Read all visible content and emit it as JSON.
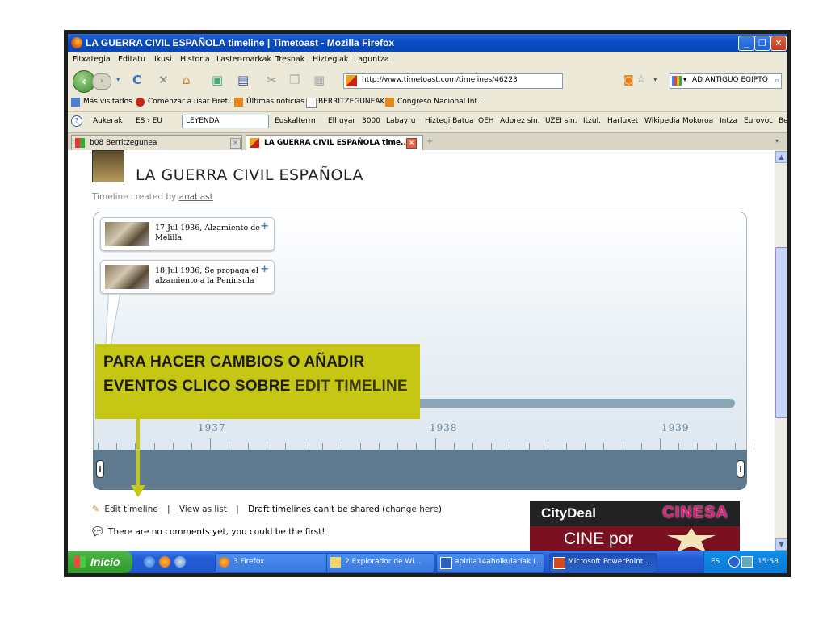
{
  "window": {
    "title": "LA GUERRA CIVIL ESPAÑOLA timeline | Timetoast - Mozilla Firefox",
    "controls": {
      "minimize": "_",
      "maximize": "❐",
      "close": "✕"
    }
  },
  "menu": {
    "items": [
      "Fitxategia",
      "Editatu",
      "Ikusi",
      "Historia",
      "Laster-markak",
      "Tresnak",
      "Hiztegiak",
      "Laguntza"
    ]
  },
  "navbar": {
    "url": "http://www.timetoast.com/timelines/46223",
    "search_text": "AD ANTIGUO EGIPTO"
  },
  "bookmarks": [
    "Más visitados",
    "Comenzar a usar Firef...",
    "Últimas noticias",
    "BERRITZEGUNEAK",
    "Congreso Nacional Int..."
  ],
  "elhuyar": {
    "aukerak": "Aukerak",
    "lang": "ES › EU",
    "field_value": "LEYENDA",
    "links": [
      "Euskalterm",
      "Elhuyar",
      "3000",
      "Labayru",
      "Hiztegi Batua",
      "OEH",
      "Adorez sin.",
      "UZEI sin.",
      "Itzul.",
      "Harluxet",
      "Wikipedia",
      "Mokoroa",
      "Intza",
      "Eurovoc",
      "Be"
    ]
  },
  "tabs": [
    {
      "label": "b08 Berritzegunea"
    },
    {
      "label": "LA GUERRA CIVIL ESPAÑOLA time..."
    }
  ],
  "page": {
    "title": "LA GUERRA CIVIL ESPAÑOLA",
    "created_prefix": "Timeline created by",
    "author": "anabast",
    "events": [
      {
        "text": "17 Jul 1936, Alzamiento de Melilla"
      },
      {
        "text": "18 Jul 1936, Se propaga el alzamiento a la Península"
      }
    ],
    "years": [
      "1937",
      "1938",
      "1939"
    ],
    "callout_main": "PARA HACER CAMBIOS O AÑADIR EVENTOS CLICO SOBRE",
    "callout_emph": "EDIT TIMELINE",
    "edit_timeline": "Edit timeline",
    "view_as_list": "View as list",
    "draft_text": "Draft timelines can't be shared (",
    "change_here": "change here",
    "draft_close": ")",
    "comments": "There are no comments yet, you could be the first!",
    "ad": {
      "brand1": "CityDeal",
      "brand2": "CINESA",
      "line": "CINE por"
    }
  },
  "taskbar": {
    "start": "Inicio",
    "tasks": [
      "3 Firefox",
      "2 Explorador de Wi...",
      "apirila14aholkulariak (...",
      "Microsoft PowerPoint ..."
    ],
    "lang": "ES",
    "time": "15:58"
  }
}
